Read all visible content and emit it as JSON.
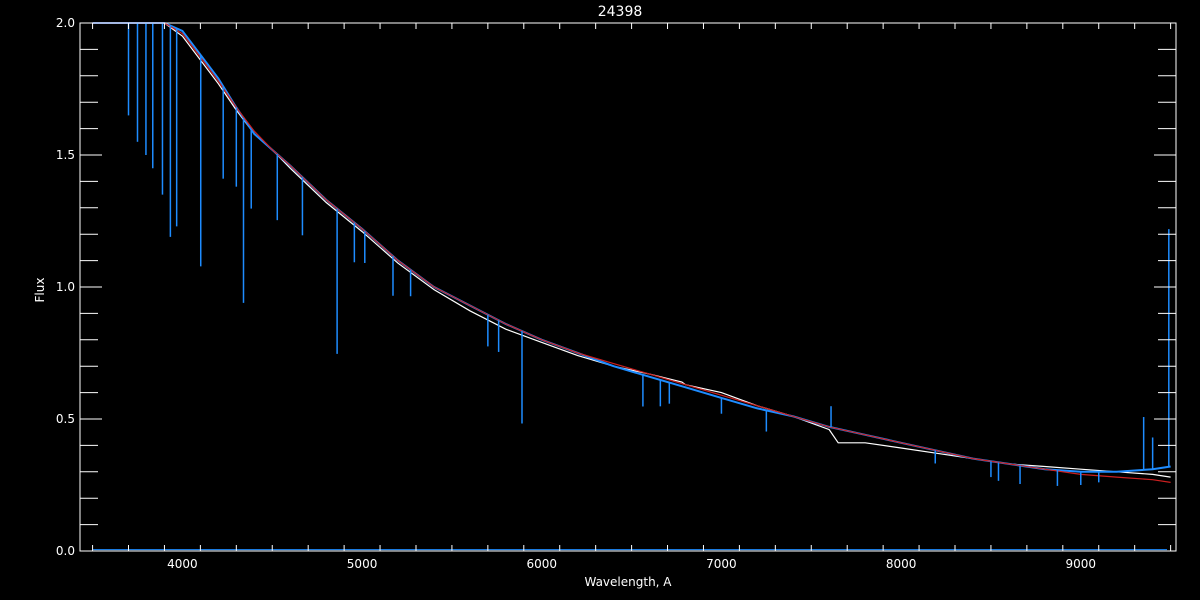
{
  "chart_data": {
    "type": "line",
    "title": "24398",
    "xlabel": "Wavelength, A",
    "ylabel": "Flux",
    "xlim": [
      3430,
      9530
    ],
    "ylim": [
      0.0,
      2.0
    ],
    "x_ticks": [
      4000,
      5000,
      6000,
      7000,
      8000,
      9000
    ],
    "x_tick_labels": [
      "4000",
      "5000",
      "6000",
      "7000",
      "8000",
      "9000"
    ],
    "y_ticks": [
      0.0,
      0.5,
      1.0,
      1.5,
      2.0
    ],
    "y_tick_labels": [
      "0.0",
      "0.5",
      "1.0",
      "1.5",
      "2.0"
    ],
    "grid": false,
    "series": [
      {
        "color": "#ffffff",
        "x": [
          3500,
          3700,
          3900,
          4000,
          4100,
          4200,
          4300,
          4400,
          4500,
          4600,
          4800,
          5000,
          5200,
          5400,
          5600,
          5800,
          6000,
          6200,
          6400,
          6600,
          6780,
          6800,
          7000,
          7200,
          7400,
          7600,
          7650,
          7800,
          8000,
          8200,
          8400,
          8600,
          8800,
          9000,
          9200,
          9400,
          9500
        ],
        "y": [
          2.0,
          2.0,
          2.0,
          1.95,
          1.86,
          1.77,
          1.67,
          1.58,
          1.52,
          1.45,
          1.32,
          1.21,
          1.09,
          0.99,
          0.91,
          0.84,
          0.79,
          0.74,
          0.7,
          0.67,
          0.64,
          0.63,
          0.6,
          0.55,
          0.51,
          0.46,
          0.41,
          0.41,
          0.39,
          0.37,
          0.35,
          0.33,
          0.32,
          0.31,
          0.3,
          0.29,
          0.28
        ]
      },
      {
        "color": "#1e8cff",
        "x": [
          3500,
          3700,
          3900,
          4000,
          4100,
          4200,
          4300,
          4400,
          4500,
          4600,
          4800,
          5000,
          5200,
          5400,
          5600,
          5800,
          6000,
          6200,
          6400,
          6600,
          6800,
          7000,
          7200,
          7400,
          7600,
          7800,
          8000,
          8200,
          8400,
          8600,
          8800,
          9000,
          9200,
          9400,
          9500
        ],
        "y": [
          2.0,
          2.0,
          2.0,
          1.97,
          1.88,
          1.79,
          1.68,
          1.58,
          1.52,
          1.46,
          1.33,
          1.22,
          1.1,
          1.0,
          0.93,
          0.86,
          0.8,
          0.75,
          0.7,
          0.66,
          0.62,
          0.58,
          0.54,
          0.51,
          0.47,
          0.44,
          0.41,
          0.38,
          0.35,
          0.33,
          0.31,
          0.3,
          0.3,
          0.31,
          0.32
        ]
      },
      {
        "color": "#cc2020",
        "x": [
          3500,
          3700,
          3900,
          4000,
          4100,
          4200,
          4300,
          4400,
          4500,
          4600,
          4800,
          5000,
          5200,
          5400,
          5600,
          5800,
          6000,
          6200,
          6400,
          6600,
          6800,
          7000,
          7200,
          7400,
          7600,
          7800,
          8000,
          8200,
          8400,
          8600,
          8800,
          9000,
          9200,
          9400,
          9500
        ],
        "y": [
          2.0,
          2.0,
          2.0,
          1.96,
          1.87,
          1.78,
          1.68,
          1.59,
          1.52,
          1.46,
          1.33,
          1.22,
          1.1,
          1.0,
          0.93,
          0.86,
          0.8,
          0.75,
          0.71,
          0.67,
          0.63,
          0.59,
          0.55,
          0.51,
          0.47,
          0.44,
          0.41,
          0.38,
          0.35,
          0.33,
          0.31,
          0.29,
          0.28,
          0.27,
          0.26
        ]
      }
    ],
    "absorption_lines": [
      {
        "x": 3700,
        "depth": 0.35
      },
      {
        "x": 3750,
        "depth": 0.45
      },
      {
        "x": 3797,
        "depth": 0.5
      },
      {
        "x": 3835,
        "depth": 0.55
      },
      {
        "x": 3889,
        "depth": 0.65
      },
      {
        "x": 3933,
        "depth": 0.8
      },
      {
        "x": 3968,
        "depth": 0.75
      },
      {
        "x": 4102,
        "depth": 0.8
      },
      {
        "x": 4227,
        "depth": 0.35
      },
      {
        "x": 4300,
        "depth": 0.3
      },
      {
        "x": 4340,
        "depth": 0.7
      },
      {
        "x": 4383,
        "depth": 0.3
      },
      {
        "x": 4528,
        "depth": 0.25
      },
      {
        "x": 4668,
        "depth": 0.22
      },
      {
        "x": 4861,
        "depth": 0.55
      },
      {
        "x": 4957,
        "depth": 0.15
      },
      {
        "x": 5015,
        "depth": 0.12
      },
      {
        "x": 5172,
        "depth": 0.15
      },
      {
        "x": 5270,
        "depth": 0.1
      },
      {
        "x": 5700,
        "depth": 0.12
      },
      {
        "x": 5760,
        "depth": 0.12
      },
      {
        "x": 5890,
        "depth": 0.35
      },
      {
        "x": 6563,
        "depth": 0.12
      },
      {
        "x": 6660,
        "depth": 0.1
      },
      {
        "x": 6710,
        "depth": 0.08
      },
      {
        "x": 7000,
        "depth": 0.06
      },
      {
        "x": 7250,
        "depth": 0.08
      },
      {
        "x": 8190,
        "depth": 0.05
      },
      {
        "x": 8500,
        "depth": 0.06
      },
      {
        "x": 8542,
        "depth": 0.07
      },
      {
        "x": 8662,
        "depth": 0.07
      },
      {
        "x": 8870,
        "depth": 0.06
      },
      {
        "x": 9000,
        "depth": 0.05
      },
      {
        "x": 9100,
        "depth": 0.04
      }
    ],
    "emission_spikes": [
      {
        "x": 7610,
        "height": 0.08
      },
      {
        "x": 9350,
        "height": 0.2
      },
      {
        "x": 9400,
        "height": 0.12
      },
      {
        "x": 9490,
        "height": 0.9
      }
    ]
  }
}
